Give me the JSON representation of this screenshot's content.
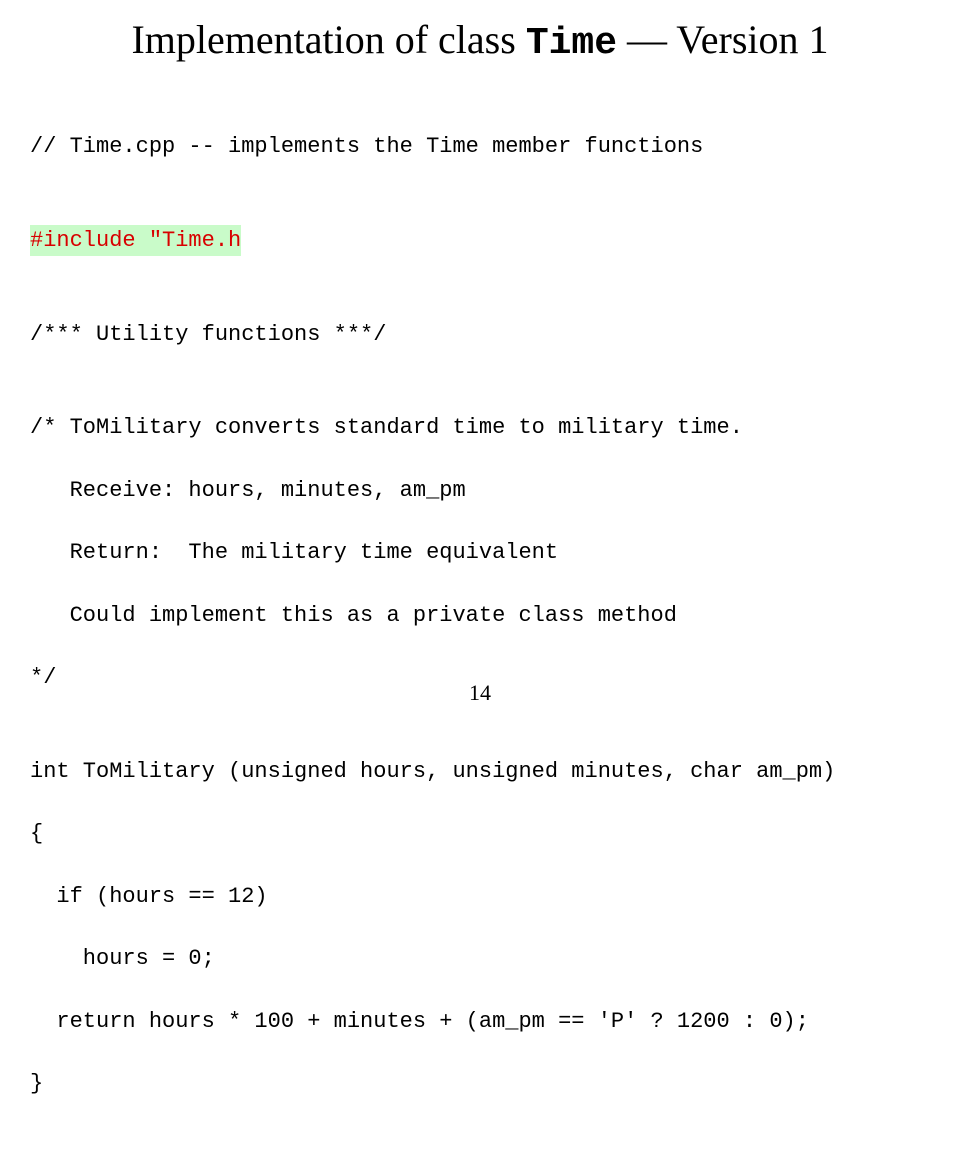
{
  "title": {
    "pre": "Implementation of class ",
    "mono": "Time",
    "post": " — Version 1"
  },
  "code": {
    "l1": "// Time.cpp -- implements the Time member functions",
    "l2": "",
    "l3": "#include \"Time.h",
    "l4": "",
    "l5": "/*** Utility functions ***/",
    "l6": "",
    "l7": "/* ToMilitary converts standard time to military time.",
    "l8": "   Receive: hours, minutes, am_pm",
    "l9": "   Return:  The military time equivalent",
    "l10": "   Could implement this as a private class method",
    "l11": "*/",
    "l12": "",
    "l13": "int ToMilitary (unsigned hours, unsigned minutes, char am_pm)",
    "l14": "{",
    "l15": "  if (hours == 12)",
    "l16": "    hours = 0;",
    "l17": "  return hours * 100 + minutes + (am_pm == 'P' ? 1200 : 0);",
    "l18": "}"
  },
  "page_number": "14"
}
